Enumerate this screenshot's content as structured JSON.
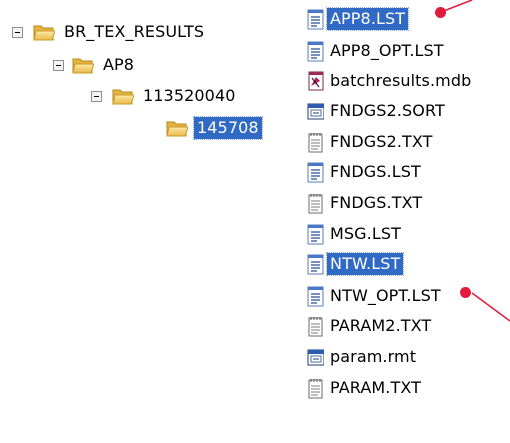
{
  "colors": {
    "selection": "#316ac5",
    "annotation": "#e21b3c"
  },
  "tree": {
    "nodes": [
      {
        "label": "BR_TEX_RESULTS",
        "icon": "folder-open-icon",
        "selected": false
      },
      {
        "label": "AP8",
        "icon": "folder-open-icon",
        "selected": false
      },
      {
        "label": "113520040",
        "icon": "folder-open-icon",
        "selected": false
      },
      {
        "label": "145708",
        "icon": "folder-open-icon",
        "selected": true
      }
    ]
  },
  "files": [
    {
      "name": "APP8.LST",
      "icon": "text-document-icon",
      "selected": true
    },
    {
      "name": "APP8_OPT.LST",
      "icon": "text-document-icon",
      "selected": false
    },
    {
      "name": "batchresults.mdb",
      "icon": "access-database-icon",
      "selected": false
    },
    {
      "name": "FNDGS2.SORT",
      "icon": "application-window-icon",
      "selected": false
    },
    {
      "name": "FNDGS2.TXT",
      "icon": "notepad-icon",
      "selected": false
    },
    {
      "name": "FNDGS.LST",
      "icon": "text-document-icon",
      "selected": false
    },
    {
      "name": "FNDGS.TXT",
      "icon": "notepad-icon",
      "selected": false
    },
    {
      "name": "MSG.LST",
      "icon": "text-document-icon",
      "selected": false
    },
    {
      "name": "NTW.LST",
      "icon": "text-document-icon",
      "selected": true
    },
    {
      "name": "NTW_OPT.LST",
      "icon": "text-document-icon",
      "selected": false
    },
    {
      "name": "PARAM2.TXT",
      "icon": "notepad-icon",
      "selected": false
    },
    {
      "name": "param.rmt",
      "icon": "application-window-icon",
      "selected": false
    },
    {
      "name": "PARAM.TXT",
      "icon": "notepad-icon",
      "selected": false
    }
  ]
}
